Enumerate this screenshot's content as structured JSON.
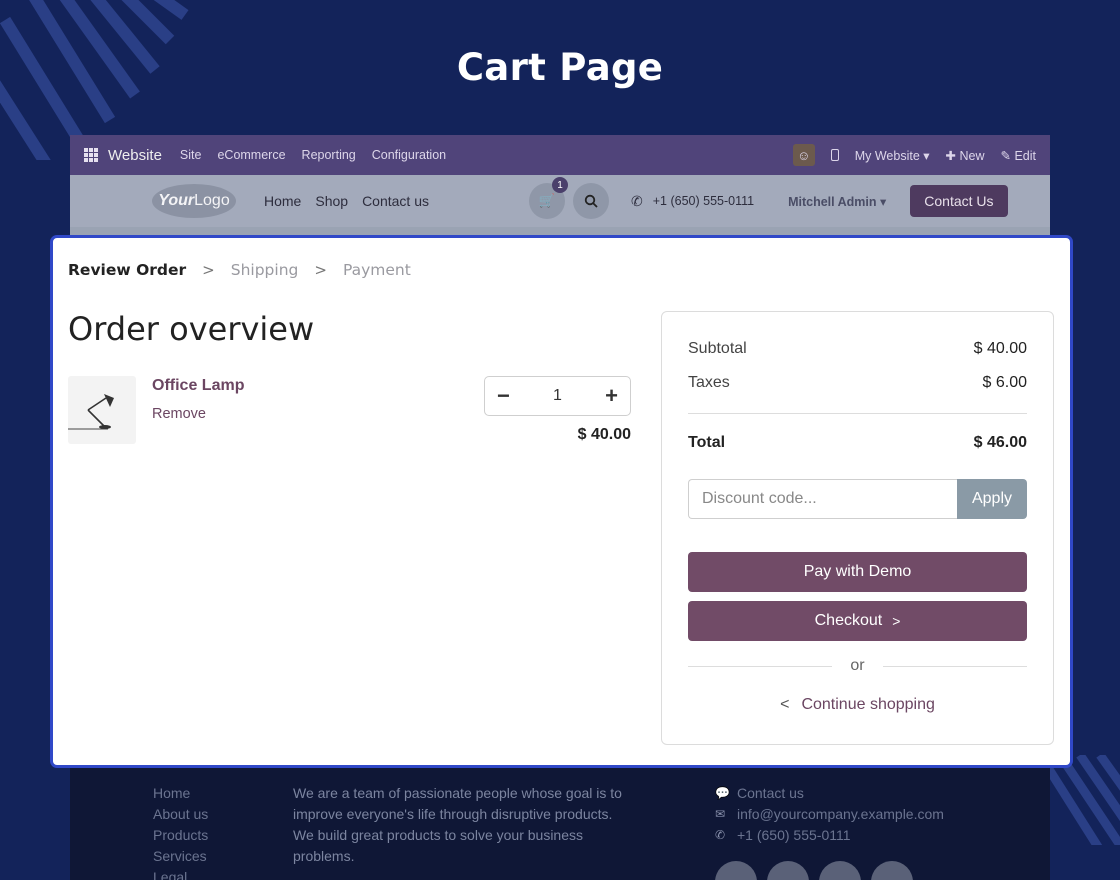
{
  "page": {
    "title": "Cart Page"
  },
  "odoo_bar": {
    "brand": "Website",
    "menu": [
      "Site",
      "eCommerce",
      "Reporting",
      "Configuration"
    ],
    "my_website": "My Website",
    "new": "New",
    "edit": "Edit"
  },
  "site_nav": {
    "logo_bold": "Your",
    "logo_light": "Logo",
    "links": [
      "Home",
      "Shop",
      "Contact us"
    ],
    "cart_count": "1",
    "phone": "+1 (650) 555-0111",
    "user": "Mitchell Admin",
    "contact_button": "Contact Us"
  },
  "checkout_steps": {
    "active": "Review Order",
    "steps": [
      "Shipping",
      "Payment"
    ]
  },
  "order": {
    "title": "Order overview",
    "item": {
      "name": "Office Lamp",
      "remove": "Remove",
      "quantity": "1",
      "price": "$ 40.00"
    }
  },
  "summary": {
    "subtotal_label": "Subtotal",
    "subtotal_value": "$ 40.00",
    "taxes_label": "Taxes",
    "taxes_value": "$ 6.00",
    "total_label": "Total",
    "total_value": "$ 46.00",
    "discount_placeholder": "Discount code...",
    "apply": "Apply",
    "pay_demo": "Pay with Demo",
    "checkout": "Checkout",
    "or": "or",
    "continue": "Continue shopping"
  },
  "footer": {
    "links": [
      "Home",
      "About us",
      "Products",
      "Services",
      "Legal"
    ],
    "about": "We are a team of passionate people whose goal is to improve everyone's life through disruptive products. We build great products to solve your business problems.",
    "contact_label": "Contact us",
    "email": "info@yourcompany.example.com",
    "phone": "+1 (650) 555-0111"
  },
  "colors": {
    "background": "#13235a",
    "accent": "#714b67",
    "highlight_border": "#3048c8",
    "apply_button": "#8a9aa6"
  }
}
